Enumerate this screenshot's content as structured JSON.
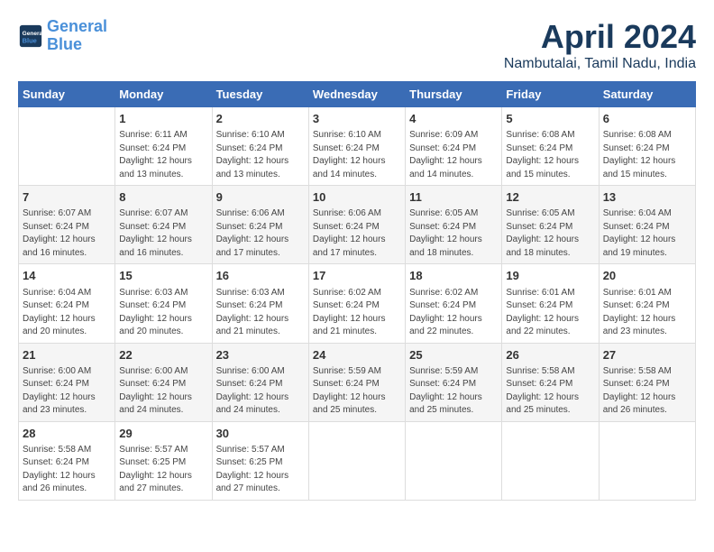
{
  "header": {
    "logo_line1": "General",
    "logo_line2": "Blue",
    "title": "April 2024",
    "subtitle": "Nambutalai, Tamil Nadu, India"
  },
  "calendar": {
    "days_of_week": [
      "Sunday",
      "Monday",
      "Tuesday",
      "Wednesday",
      "Thursday",
      "Friday",
      "Saturday"
    ],
    "weeks": [
      [
        {
          "day": "",
          "info": ""
        },
        {
          "day": "1",
          "info": "Sunrise: 6:11 AM\nSunset: 6:24 PM\nDaylight: 12 hours\nand 13 minutes."
        },
        {
          "day": "2",
          "info": "Sunrise: 6:10 AM\nSunset: 6:24 PM\nDaylight: 12 hours\nand 13 minutes."
        },
        {
          "day": "3",
          "info": "Sunrise: 6:10 AM\nSunset: 6:24 PM\nDaylight: 12 hours\nand 14 minutes."
        },
        {
          "day": "4",
          "info": "Sunrise: 6:09 AM\nSunset: 6:24 PM\nDaylight: 12 hours\nand 14 minutes."
        },
        {
          "day": "5",
          "info": "Sunrise: 6:08 AM\nSunset: 6:24 PM\nDaylight: 12 hours\nand 15 minutes."
        },
        {
          "day": "6",
          "info": "Sunrise: 6:08 AM\nSunset: 6:24 PM\nDaylight: 12 hours\nand 15 minutes."
        }
      ],
      [
        {
          "day": "7",
          "info": "Sunrise: 6:07 AM\nSunset: 6:24 PM\nDaylight: 12 hours\nand 16 minutes."
        },
        {
          "day": "8",
          "info": "Sunrise: 6:07 AM\nSunset: 6:24 PM\nDaylight: 12 hours\nand 16 minutes."
        },
        {
          "day": "9",
          "info": "Sunrise: 6:06 AM\nSunset: 6:24 PM\nDaylight: 12 hours\nand 17 minutes."
        },
        {
          "day": "10",
          "info": "Sunrise: 6:06 AM\nSunset: 6:24 PM\nDaylight: 12 hours\nand 17 minutes."
        },
        {
          "day": "11",
          "info": "Sunrise: 6:05 AM\nSunset: 6:24 PM\nDaylight: 12 hours\nand 18 minutes."
        },
        {
          "day": "12",
          "info": "Sunrise: 6:05 AM\nSunset: 6:24 PM\nDaylight: 12 hours\nand 18 minutes."
        },
        {
          "day": "13",
          "info": "Sunrise: 6:04 AM\nSunset: 6:24 PM\nDaylight: 12 hours\nand 19 minutes."
        }
      ],
      [
        {
          "day": "14",
          "info": "Sunrise: 6:04 AM\nSunset: 6:24 PM\nDaylight: 12 hours\nand 20 minutes."
        },
        {
          "day": "15",
          "info": "Sunrise: 6:03 AM\nSunset: 6:24 PM\nDaylight: 12 hours\nand 20 minutes."
        },
        {
          "day": "16",
          "info": "Sunrise: 6:03 AM\nSunset: 6:24 PM\nDaylight: 12 hours\nand 21 minutes."
        },
        {
          "day": "17",
          "info": "Sunrise: 6:02 AM\nSunset: 6:24 PM\nDaylight: 12 hours\nand 21 minutes."
        },
        {
          "day": "18",
          "info": "Sunrise: 6:02 AM\nSunset: 6:24 PM\nDaylight: 12 hours\nand 22 minutes."
        },
        {
          "day": "19",
          "info": "Sunrise: 6:01 AM\nSunset: 6:24 PM\nDaylight: 12 hours\nand 22 minutes."
        },
        {
          "day": "20",
          "info": "Sunrise: 6:01 AM\nSunset: 6:24 PM\nDaylight: 12 hours\nand 23 minutes."
        }
      ],
      [
        {
          "day": "21",
          "info": "Sunrise: 6:00 AM\nSunset: 6:24 PM\nDaylight: 12 hours\nand 23 minutes."
        },
        {
          "day": "22",
          "info": "Sunrise: 6:00 AM\nSunset: 6:24 PM\nDaylight: 12 hours\nand 24 minutes."
        },
        {
          "day": "23",
          "info": "Sunrise: 6:00 AM\nSunset: 6:24 PM\nDaylight: 12 hours\nand 24 minutes."
        },
        {
          "day": "24",
          "info": "Sunrise: 5:59 AM\nSunset: 6:24 PM\nDaylight: 12 hours\nand 25 minutes."
        },
        {
          "day": "25",
          "info": "Sunrise: 5:59 AM\nSunset: 6:24 PM\nDaylight: 12 hours\nand 25 minutes."
        },
        {
          "day": "26",
          "info": "Sunrise: 5:58 AM\nSunset: 6:24 PM\nDaylight: 12 hours\nand 25 minutes."
        },
        {
          "day": "27",
          "info": "Sunrise: 5:58 AM\nSunset: 6:24 PM\nDaylight: 12 hours\nand 26 minutes."
        }
      ],
      [
        {
          "day": "28",
          "info": "Sunrise: 5:58 AM\nSunset: 6:24 PM\nDaylight: 12 hours\nand 26 minutes."
        },
        {
          "day": "29",
          "info": "Sunrise: 5:57 AM\nSunset: 6:25 PM\nDaylight: 12 hours\nand 27 minutes."
        },
        {
          "day": "30",
          "info": "Sunrise: 5:57 AM\nSunset: 6:25 PM\nDaylight: 12 hours\nand 27 minutes."
        },
        {
          "day": "",
          "info": ""
        },
        {
          "day": "",
          "info": ""
        },
        {
          "day": "",
          "info": ""
        },
        {
          "day": "",
          "info": ""
        }
      ]
    ]
  }
}
